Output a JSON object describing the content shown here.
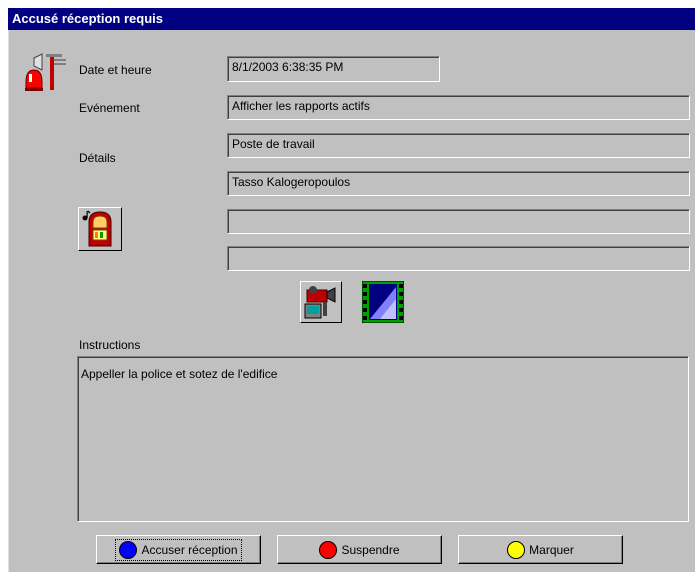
{
  "window": {
    "title": "Accusé réception requis"
  },
  "labels": {
    "date": "Date et heure",
    "event": "Evénement",
    "details": "Détails",
    "instructions": "Instructions"
  },
  "fields": {
    "date_value": "8/1/2003 6:38:35 PM",
    "event_value": "Afficher les rapports actifs",
    "detail1": "Poste de travail",
    "detail2": "Tasso Kalogeropoulos",
    "detail3": "",
    "detail4": "",
    "instructions_text": "Appeller la police et sotez de l'edifice"
  },
  "buttons": {
    "acknowledge": "Accuser réception",
    "suspend": "Suspendre",
    "mark": "Marquer"
  },
  "colors": {
    "titlebar": "#000080",
    "window_bg": "#c0c0c0",
    "acknowledge_dot": "#0000ff",
    "suspend_dot": "#ff0000",
    "mark_dot": "#ffff00"
  },
  "icons": [
    "alarm-siren-icon",
    "jukebox-sound-icon",
    "video-camera-icon",
    "video-clip-icon"
  ]
}
